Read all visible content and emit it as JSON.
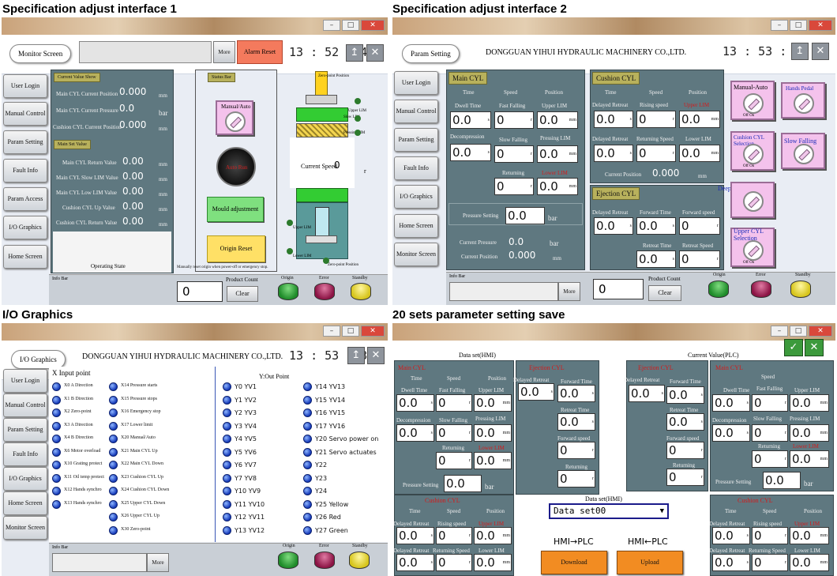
{
  "titles": {
    "q1": "Specification adjust interface 1",
    "q2": "Specification adjust interface 2",
    "q3": "I/O Graphics",
    "q4": "20 sets parameter setting save"
  },
  "company": "DONGGUAN YIHUI HYDRAULIC MACHINERY CO.,LTD.",
  "side_menu_1": [
    "User Login",
    "Manual Control",
    "Param Setting",
    "Fault Info",
    "Param Access",
    "I/O Graphics",
    "Home Screen"
  ],
  "side_menu_2": [
    "User Login",
    "Manual Control",
    "Param Setting",
    "Fault Info",
    "I/O Graphics",
    "Home Screen",
    "Monitor Screen"
  ],
  "side_menu_3": [
    "User Login",
    "Manual Control",
    "Param Setting",
    "Fault Info",
    "I/O Graphics",
    "Home Screen",
    "Monitor Screen"
  ],
  "q1": {
    "screen": "Monitor Screen",
    "more": "More",
    "alarm_reset": "Alarm Reset",
    "clock": "13 : 52 : 49",
    "current_value_show": "Current Value Show",
    "main_set_value": "Main Set Value",
    "status_bar": "Status Bar",
    "rows_top": [
      {
        "label": "Main CYL Current Position",
        "value": "0.000",
        "unit": "mm"
      },
      {
        "label": "Main CYL Current Pressure",
        "value": "0.0",
        "unit": "bar"
      },
      {
        "label": "Cushion CYL Current Position",
        "value": "0.000",
        "unit": "mm"
      }
    ],
    "rows_set": [
      {
        "label": "Main CYL Return Value",
        "value": "0.00",
        "unit": "mm"
      },
      {
        "label": "Main CYL Slow LIM Value",
        "value": "0.00",
        "unit": "mm"
      },
      {
        "label": "Main CYL Low LIM Value",
        "value": "0.00",
        "unit": "mm"
      },
      {
        "label": "Cushion CYL Up Value",
        "value": "0.00",
        "unit": "mm"
      },
      {
        "label": "Cushion CYL Return Value",
        "value": "0.00",
        "unit": "mm"
      }
    ],
    "operating_state": "Operating State",
    "manual_auto": "Manual/Auto",
    "auto_run": "Auto Run",
    "mould_adjustment": "Mould adjustment",
    "origin_reset": "Origin Reset",
    "origin_note": "Manually reset origin when power-off or emergency stop.",
    "current_speed": "Current Speed",
    "current_speed_value": "0",
    "current_speed_unit": "r",
    "diagram_labels": {
      "zero_top": "Zero-point Position",
      "upper_lim": "Upper LIM",
      "slow_lim": "Slow LIM",
      "pressing_lim": "Pressing LIM",
      "upper_lim2": "Upper LIM",
      "lower_lim": "Lower LIM",
      "zero_bottom": "Zero-point Position"
    },
    "info_bar": "Info Bar",
    "product_count": "Product Count",
    "count_value": "0",
    "clear": "Clear",
    "lamps": [
      "Origin",
      "Error",
      "Standby"
    ]
  },
  "q2": {
    "screen": "Param Setting",
    "clock": "13 : 53 : 19",
    "main_cyl": "Main CYL",
    "cushion_cyl": "Cushion CYL",
    "ejection_cyl": "Ejection CYL",
    "hdr_time": "Time",
    "hdr_speed": "Speed",
    "hdr_position": "Position",
    "dwell_time": "Dwell Time",
    "dwell_value": "0.0",
    "s": "s",
    "fast_falling": "Fast Falling",
    "fast_value": "0",
    "r": "r",
    "upper_lim": "Upper LIM",
    "upper_value": "0.0",
    "mm": "mm",
    "decompression": "Decompression",
    "decomp_value": "0.0",
    "slow_falling": "Slow Falling",
    "slow_value": "0",
    "pressing_lim": "Pressing LIM",
    "pressing_value": "0.0",
    "returning": "Returning",
    "returning_value": "0",
    "lower_lim": "Lower LIM",
    "lower_value": "0.0",
    "pressure_setting": "Pressure Setting",
    "pressure_value": "0.0",
    "bar": "bar",
    "current_pressure": "Current Pressure",
    "current_pressure_value": "0.0",
    "current_position": "Current Position",
    "current_position_value": "0.000",
    "delayed_retreat": "Delayed Retreat",
    "rising_speed": "Rising speed",
    "upper_lim_red": "Upper LIM",
    "cushion_delay_value": "0.0",
    "rising_value": "0",
    "cushion_upper_value": "0.0",
    "returning_speed": "Returning Speed",
    "cushion_lower": "Lower LIM",
    "cushion_delay2": "0.0",
    "returning_speed_value": "0",
    "cushion_lower_value": "0.0",
    "cushion_current_position": "Current Position",
    "cushion_current_value": "0.000",
    "forward_time": "Forward Time",
    "forward_speed": "Forward speed",
    "ej_delay_value": "0.0",
    "ej_forward_time": "0.0",
    "ej_forward_speed": "0",
    "retreat_time": "Retreat Time",
    "retreat_speed": "Retreat Speed",
    "ej_retreat_time": "0.0",
    "ej_retreat_speed": "0",
    "manual_auto": "Manual-Auto",
    "off_on": "Off  On",
    "hands_pedal": "Hands Pedal",
    "cushion_cyl_selection": "Cushion CYL Selection",
    "slow_falling_btn": "Slow Falling",
    "deep_drawing": "Deep Drawing/Lifting",
    "upper_cyl_selection": "Upper CYL Selection",
    "info_bar": "Info Bar",
    "more": "More",
    "product_count": "Product Count",
    "count_value": "0",
    "clear": "Clear",
    "lamps": [
      "Origin",
      "Error",
      "Standby"
    ]
  },
  "q3": {
    "screen": "I/O Graphics",
    "clock": "13 : 53 : 34",
    "x_title": "X Input point",
    "y_title": "Y:Out Point",
    "x_col1": [
      "X0 A Direction",
      "X1 B Direction",
      "X2 Zero-point",
      "X3 A Direction",
      "X4 B Direction",
      "X6 Motor overload",
      "X10 Grating protect",
      "X11 Oil temp protect",
      "X12 Hands synchro",
      "X13 Hands synchro"
    ],
    "x_col2": [
      "X14 Pressure starts",
      "X15 Pressure stops",
      "X16 Emergency stop",
      "X17 Lower limit",
      "X20 Manual/Auto",
      "X21 Main CYL Up",
      "X22 Main CYL Down",
      "X23 Cushion CYL Up",
      "X24 Cushion CYL Down",
      "X25 Upper CYL Down",
      "X26 Upper CYL Up",
      "X30 Zero-point"
    ],
    "y_col1": [
      "Y0  YV1",
      "Y1  YV2",
      "Y2  YV3",
      "Y3  YV4",
      "Y4  YV5",
      "Y5  YV6",
      "Y6  YV7",
      "Y7  YV8",
      "Y10  YV9",
      "Y11  YV10",
      "Y12  YV11",
      "Y13  YV12"
    ],
    "y_col2": [
      "Y14  YV13",
      "Y15  YV14",
      "Y16  YV15",
      "Y17  YV16",
      "Y20 Servo power on",
      "Y21 Servo actuates",
      "Y22",
      "Y23",
      "Y24",
      "Y25 Yellow",
      "Y26 Red",
      "Y27 Green"
    ],
    "info_bar": "Info Bar",
    "more": "More",
    "lamps": [
      "Origin",
      "Error",
      "Standby"
    ]
  },
  "q4": {
    "data_set_hmi": "Data set(HMI)",
    "current_value_plc": "Current Value(PLC)",
    "main_cyl": "Main CYL",
    "ejection_cyl": "Ejection CYL",
    "cushion_cyl": "Cushion CYL",
    "time": "Time",
    "speed": "Speed",
    "position": "Position",
    "dwell_time": "Dwell Time",
    "fast_falling": "Fast Falling",
    "upper_lim": "Upper LIM",
    "decompression": "Decompression",
    "slow_falling": "Slow Falling",
    "pressing_lim": "Pressing LIM",
    "returning": "Returning",
    "lower_lim": "Lower LIM",
    "pressure_setting": "Pressure Setting",
    "bar": "bar",
    "delayed_retreat": "Delayed Retreat",
    "forward_time": "Forward Time",
    "retreat_time": "Retreat Time",
    "forward_speed": "Forward speed",
    "rising_speed": "Rising speed",
    "returning_speed": "Returning Speed",
    "zero_decimal": "0.0",
    "zero": "0",
    "s": "s",
    "r": "r",
    "mm": "mm",
    "selector_label": "Data set(HMI)",
    "selector_value": "Data set00",
    "hmi_to_plc": "HMI→PLC",
    "plc_to_hmi": "HMI←PLC",
    "download": "Download",
    "upload": "Upload"
  }
}
